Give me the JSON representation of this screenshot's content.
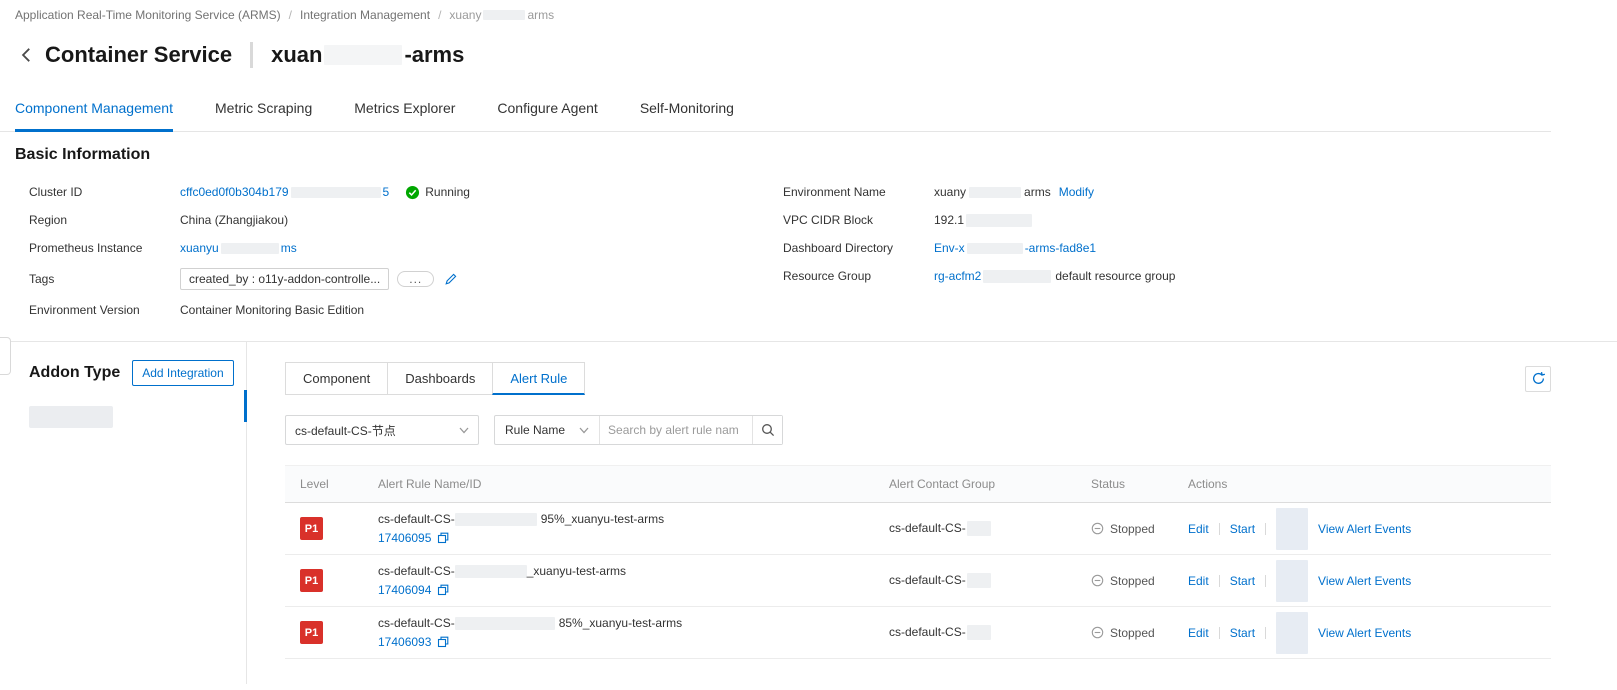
{
  "colors": {
    "accent": "#0070cc",
    "level_p1_red": "#d9312a",
    "running_green": "#00a700"
  },
  "breadcrumb": {
    "sep": "/",
    "item1": "Application Real-Time Monitoring Service (ARMS)",
    "item2": "Integration Management",
    "item3_prefix": "xuany",
    "item3_suffix": "arms"
  },
  "header": {
    "title": "Container Service",
    "instance_prefix": "xuan",
    "instance_suffix": "-arms"
  },
  "nav_tabs": {
    "component_management": "Component Management",
    "metric_scraping": "Metric Scraping",
    "metrics_explorer": "Metrics Explorer",
    "configure_agent": "Configure Agent",
    "self_monitoring": "Self-Monitoring"
  },
  "basic_info": {
    "section_title": "Basic Information",
    "cluster_id": {
      "label": "Cluster ID",
      "value": "cffc0ed0f0b304b179",
      "tail": "5",
      "status": "Running"
    },
    "region": {
      "label": "Region",
      "value": "China (Zhangjiakou)"
    },
    "prometheus": {
      "label": "Prometheus Instance",
      "value": "xuanyu",
      "tail": "ms"
    },
    "tags": {
      "label": "Tags",
      "chip": "created_by : o11y-addon-controlle...",
      "more": "..."
    },
    "environment_version": {
      "label": "Environment Version",
      "value": "Container Monitoring Basic Edition"
    },
    "environment_name": {
      "label": "Environment Name",
      "value": "xuany",
      "tail": "arms",
      "modify": "Modify"
    },
    "vpc_cidr": {
      "label": "VPC CIDR Block",
      "value": "192.1"
    },
    "dashboard_directory": {
      "label": "Dashboard Directory",
      "value": "Env-x",
      "tail": "-arms-fad8e1"
    },
    "resource_group": {
      "label": "Resource Group",
      "value": "rg-acfm2",
      "note": "default resource group"
    }
  },
  "addon": {
    "title": "Addon Type",
    "add_button": "Add Integration"
  },
  "panel_tabs": {
    "component": "Component",
    "dashboards": "Dashboards",
    "alert_rule": "Alert Rule"
  },
  "filters": {
    "type_value": "cs-default-CS-节点",
    "rule_name": "Rule Name",
    "search_placeholder": "Search by alert rule nam"
  },
  "table": {
    "headers": {
      "level": "Level",
      "name": "Alert Rule Name/ID",
      "contact": "Alert Contact Group",
      "status": "Status",
      "actions": "Actions"
    },
    "actions": {
      "edit": "Edit",
      "start": "Start",
      "view": "View Alert Events"
    },
    "status_stopped": "Stopped",
    "rows": [
      {
        "level": "P1",
        "name_prefix": "cs-default-CS-",
        "name_suffix": "95%_xuanyu-test-arms",
        "id": "17406095",
        "contact": "cs-default-CS-"
      },
      {
        "level": "P1",
        "name_prefix": "cs-default-CS-",
        "name_suffix": "_xuanyu-test-arms",
        "id": "17406094",
        "contact": "cs-default-CS-"
      },
      {
        "level": "P1",
        "name_prefix": "cs-default-CS-",
        "name_suffix": "85%_xuanyu-test-arms",
        "id": "17406093",
        "contact": "cs-default-CS-"
      }
    ]
  }
}
